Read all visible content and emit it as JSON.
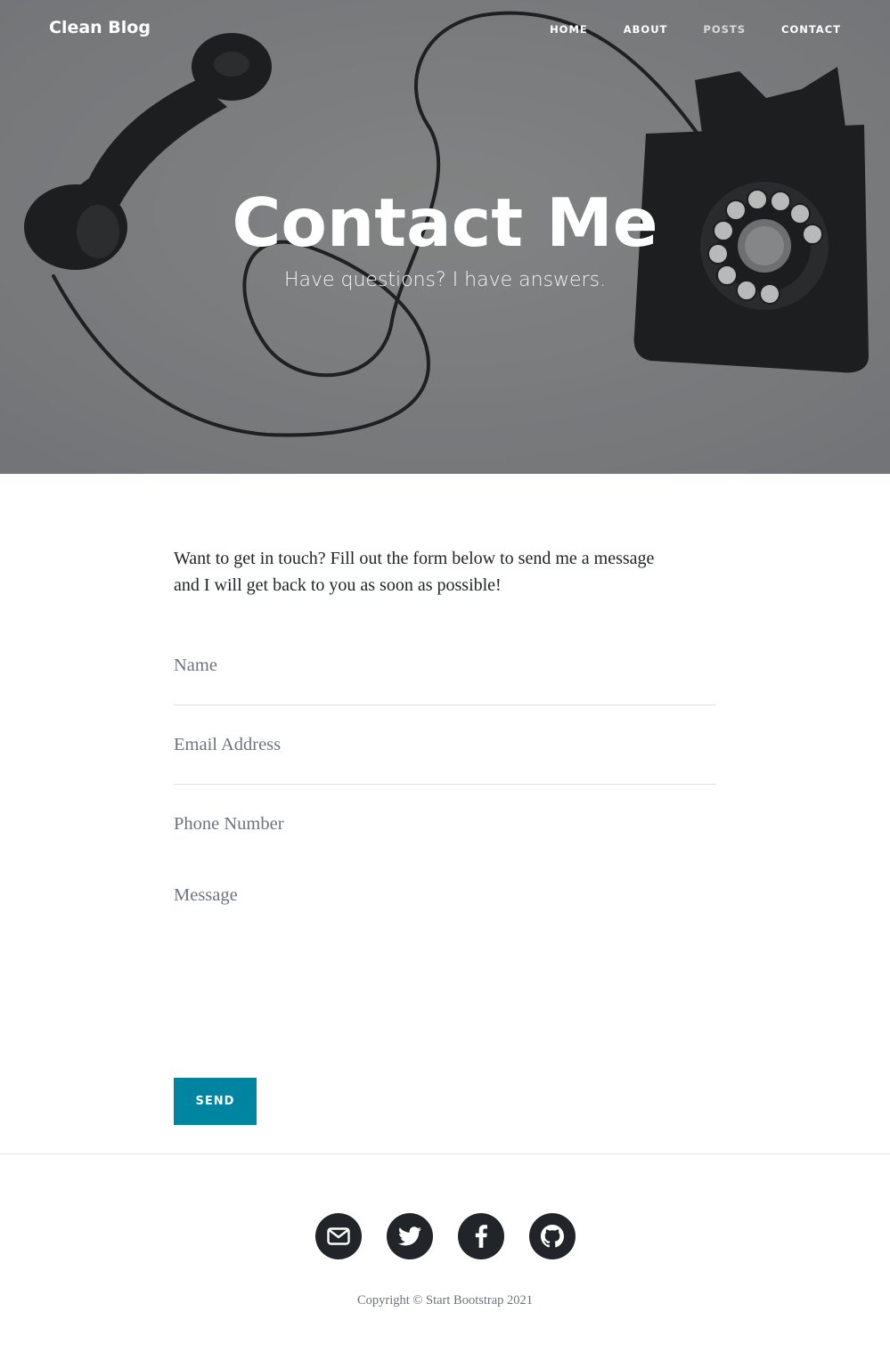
{
  "navbar": {
    "brand": "Clean Blog",
    "links": [
      {
        "label": "Home"
      },
      {
        "label": "About"
      },
      {
        "label": "Posts"
      },
      {
        "label": "Contact"
      }
    ]
  },
  "hero": {
    "title": "Contact Me",
    "subtitle": "Have questions? I have answers."
  },
  "main": {
    "intro": "Want to get in touch? Fill out the form below to send me a message and I will get back to you as soon as possible!",
    "form": {
      "name_placeholder": "Name",
      "name_value": "",
      "email_placeholder": "Email Address",
      "email_value": "",
      "phone_placeholder": "Phone Number",
      "phone_value": "",
      "message_placeholder": "Message",
      "message_value": "",
      "send_label": "Send"
    }
  },
  "footer": {
    "social_icons": [
      "envelope-icon",
      "twitter-icon",
      "facebook-icon",
      "github-icon"
    ],
    "copyright": "Copyright © Start Bootstrap 2021"
  },
  "colors": {
    "accent": "#0085a1",
    "dark": "#212529",
    "hero_overlay": "#8a8b8e"
  }
}
